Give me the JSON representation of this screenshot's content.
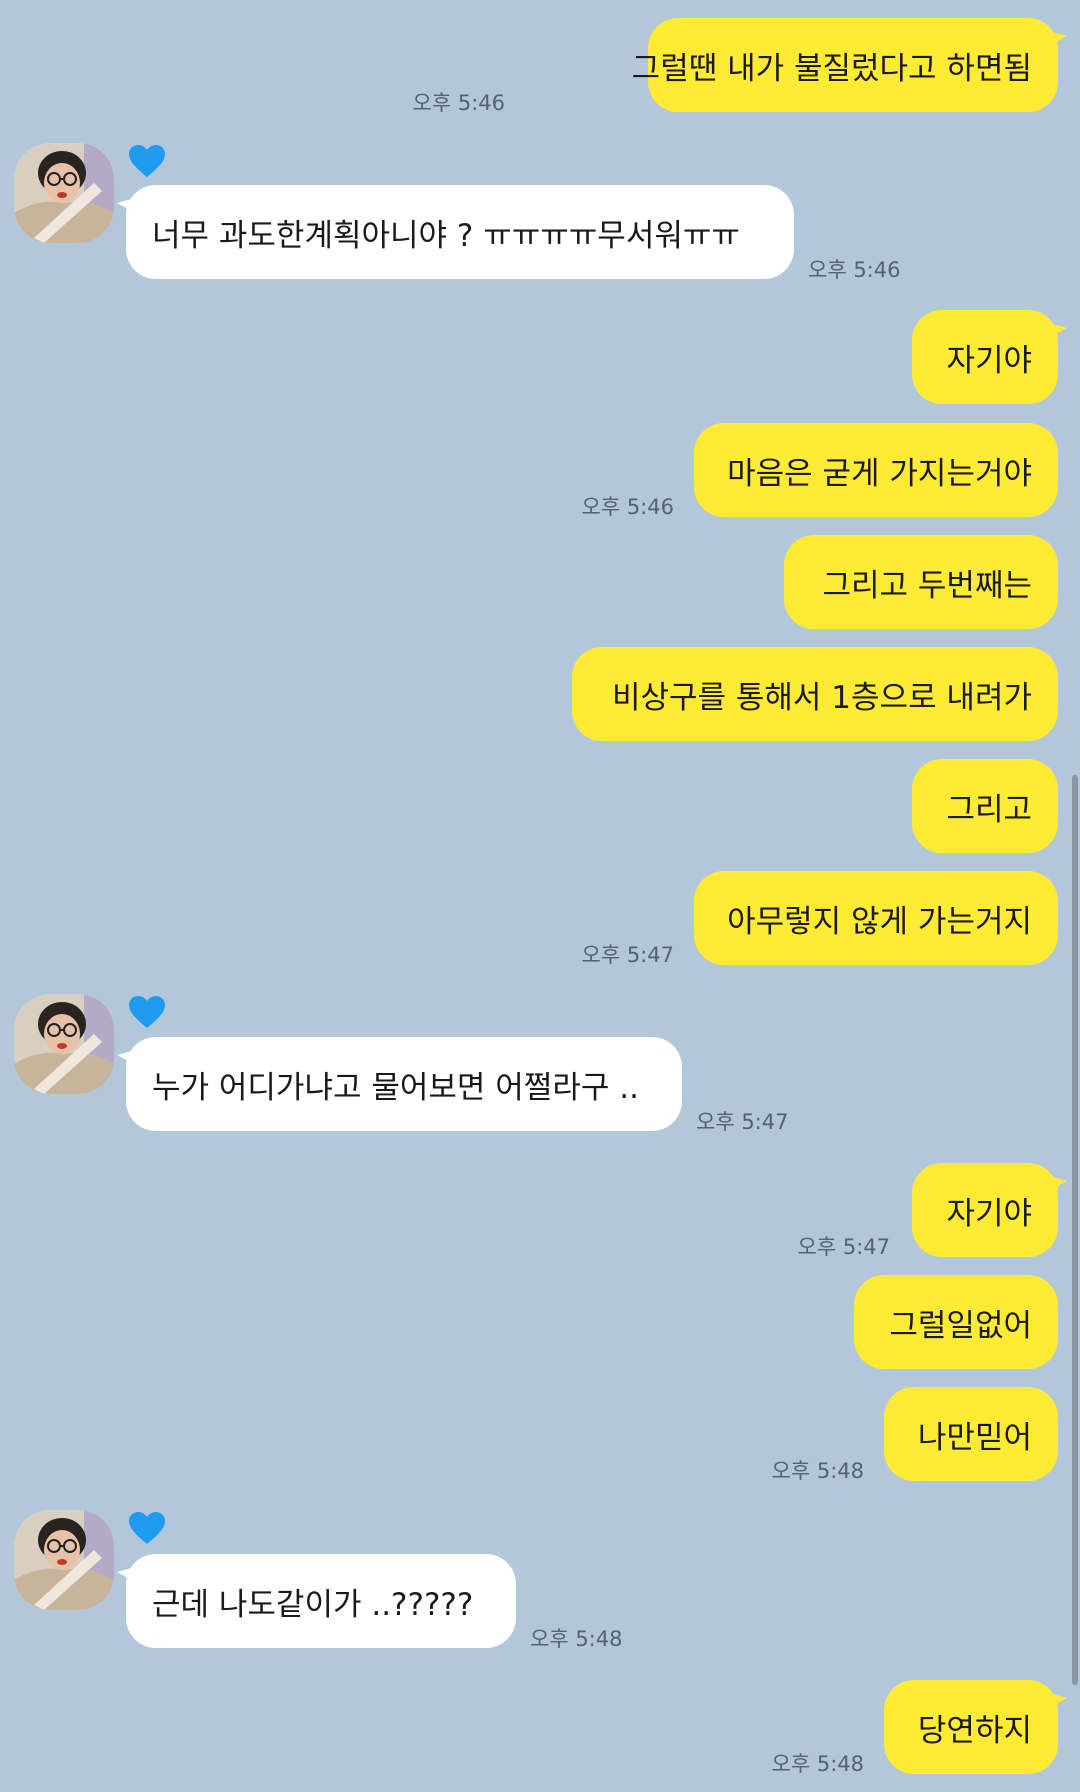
{
  "messages": [
    {
      "side": "me",
      "text": "그럴땐 내가 불질렀다고 하면됨",
      "time": "오후 5:46"
    },
    {
      "side": "other",
      "text": "너무 과도한계획아니야 ? ㅠㅠㅠㅠ무서워ㅠㅠ",
      "time": "오후 5:46"
    },
    {
      "side": "me",
      "text": "자기야",
      "time": ""
    },
    {
      "side": "me",
      "text": "마음은 굳게 가지는거야",
      "time": "오후 5:46"
    },
    {
      "side": "me",
      "text": "그리고 두번째는",
      "time": ""
    },
    {
      "side": "me",
      "text": "비상구를 통해서 1층으로 내려가",
      "time": ""
    },
    {
      "side": "me",
      "text": "그리고",
      "time": ""
    },
    {
      "side": "me",
      "text": "아무렇지 않게 가는거지",
      "time": "오후 5:47"
    },
    {
      "side": "other",
      "text": "누가 어디가냐고 물어보면 어쩔라구 ..",
      "time": "오후 5:47"
    },
    {
      "side": "me",
      "text": "자기야",
      "time": "오후 5:47"
    },
    {
      "side": "me",
      "text": "그럴일없어",
      "time": ""
    },
    {
      "side": "me",
      "text": "나만믿어",
      "time": "오후 5:48"
    },
    {
      "side": "other",
      "text": "근데 나도같이가 ..?????",
      "time": "오후 5:48"
    },
    {
      "side": "me",
      "text": "당연하지",
      "time": "오후 5:48"
    }
  ],
  "icons": {
    "heart": "blue-heart-icon",
    "avatar": "profile-avatar"
  },
  "colors": {
    "background": "#b2c7da",
    "my_bubble": "#ffeb33",
    "other_bubble": "#ffffff",
    "heart": "#1e9bf0"
  }
}
